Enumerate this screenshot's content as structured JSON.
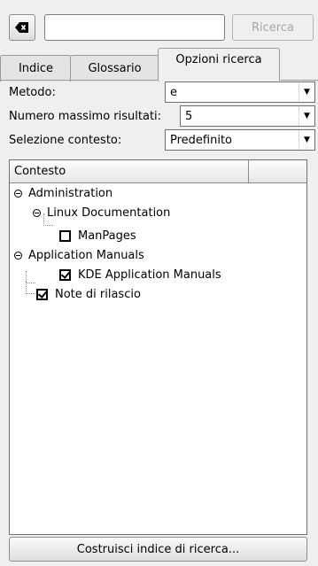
{
  "search": {
    "value": "",
    "placeholder": "",
    "button_label": "Ricerca",
    "clear_icon": "clear-input-icon"
  },
  "tabs": [
    {
      "label": "Indice",
      "mnemonic": "I"
    },
    {
      "label": "Glossario",
      "mnemonic": "l"
    },
    {
      "label": "Opzioni ricerca",
      "mnemonic": "z",
      "active": true
    }
  ],
  "options": {
    "method": {
      "label": "Metodo:",
      "value": "e"
    },
    "max_results": {
      "label": "Numero massimo risultati:",
      "value": "5"
    },
    "context_selection": {
      "label": "Selezione contesto:",
      "value": "Predefinito"
    }
  },
  "context_list": {
    "column_header": "Contesto",
    "items": [
      {
        "label": "Administration",
        "kind": "group",
        "expanded": true
      },
      {
        "label": "Linux Documentation",
        "kind": "group",
        "expanded": true
      },
      {
        "label": "ManPages",
        "kind": "check",
        "checked": false
      },
      {
        "label": "Application Manuals",
        "kind": "group",
        "expanded": true
      },
      {
        "label": "KDE Application Manuals",
        "kind": "check",
        "checked": true
      },
      {
        "label": "Note di rilascio",
        "kind": "check",
        "checked": true
      }
    ]
  },
  "build_button": {
    "label": "Costruisci indice di ricerca..."
  }
}
